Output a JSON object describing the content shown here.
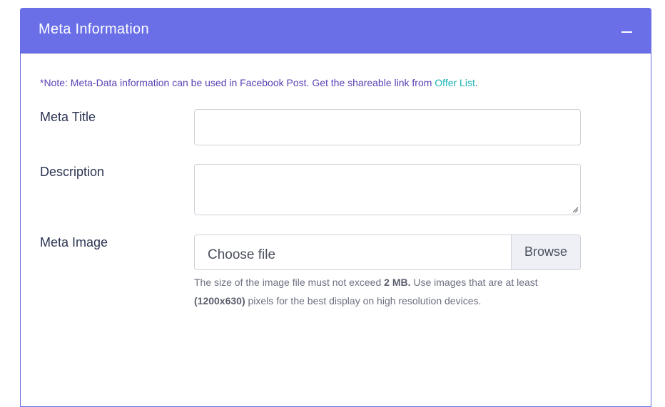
{
  "panel": {
    "title": "Meta Information",
    "collapse_icon": "minus-icon"
  },
  "note": {
    "text": "*Note: Meta-Data information can be used in Facebook Post. Get the shareable link from ",
    "link_text": "Offer List",
    "suffix": "."
  },
  "fields": {
    "meta_title": {
      "label": "Meta Title",
      "value": "",
      "placeholder": ""
    },
    "description": {
      "label": "Description",
      "value": "",
      "placeholder": ""
    },
    "meta_image": {
      "label": "Meta Image",
      "file_placeholder": "Choose file",
      "browse_label": "Browse"
    }
  },
  "help": {
    "part1": "The size of the image file must not exceed ",
    "max_size": "2 MB.",
    "part2": " Use images that are at least ",
    "dimensions": "(1200x630)",
    "part3": " pixels for the best display on high resolution devices."
  },
  "colors": {
    "header_bg": "#6a6fe8",
    "note_text": "#5b3fb3",
    "link": "#19b3b3"
  }
}
